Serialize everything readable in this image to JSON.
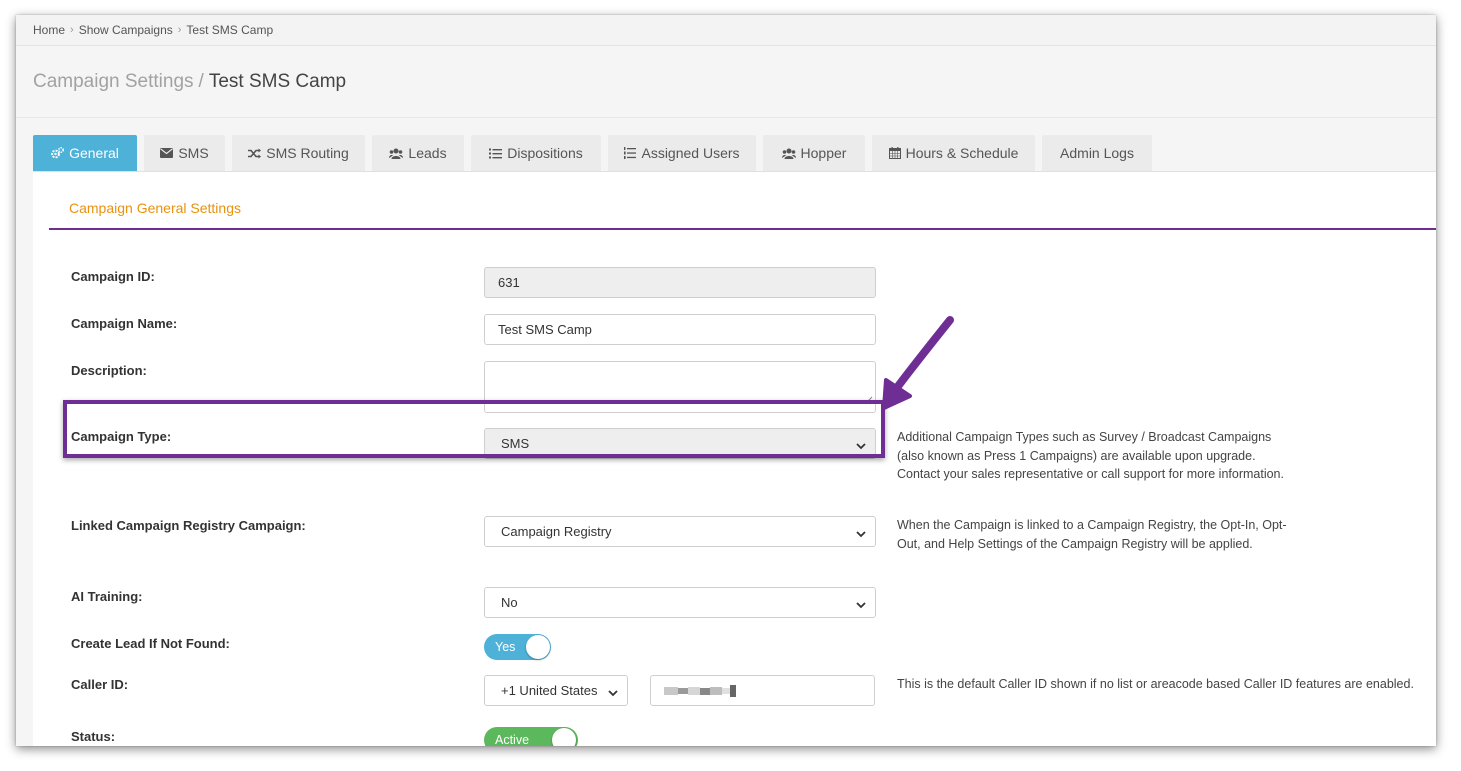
{
  "breadcrumb": {
    "items": [
      "Home",
      "Show Campaigns",
      "Test SMS Camp"
    ]
  },
  "header": {
    "section": "Campaign Settings",
    "separator": "/",
    "campaign": "Test SMS Camp"
  },
  "tabs": [
    {
      "label": "General",
      "icon": "gears-icon",
      "active": true
    },
    {
      "label": "SMS",
      "icon": "envelope-icon",
      "active": false
    },
    {
      "label": "SMS Routing",
      "icon": "shuffle-icon",
      "active": false
    },
    {
      "label": "Leads",
      "icon": "users-icon",
      "active": false
    },
    {
      "label": "Dispositions",
      "icon": "list-icon",
      "active": false
    },
    {
      "label": "Assigned Users",
      "icon": "ordered-list-icon",
      "active": false
    },
    {
      "label": "Hopper",
      "icon": "users-icon",
      "active": false
    },
    {
      "label": "Hours & Schedule",
      "icon": "calendar-icon",
      "active": false
    },
    {
      "label": "Admin Logs",
      "icon": "",
      "active": false
    }
  ],
  "section_title": "Campaign General Settings",
  "form": {
    "campaign_id": {
      "label": "Campaign ID:",
      "value": "631"
    },
    "campaign_name": {
      "label": "Campaign Name:",
      "value": "Test SMS Camp"
    },
    "description": {
      "label": "Description:",
      "value": ""
    },
    "campaign_type": {
      "label": "Campaign Type:",
      "value": "SMS",
      "help": "Additional Campaign Types such as Survey / Broadcast Campaigns (also known as Press 1 Campaigns) are available upon upgrade. Contact your sales representative or call support for more information."
    },
    "linked_registry": {
      "label": "Linked Campaign Registry Campaign:",
      "value": "Campaign Registry",
      "help": "When the Campaign is linked to a Campaign Registry, the Opt-In, Opt-Out, and Help Settings of the Campaign Registry will be applied."
    },
    "ai_training": {
      "label": "AI Training:",
      "value": "No"
    },
    "create_lead": {
      "label": "Create Lead If Not Found:",
      "value": "Yes"
    },
    "caller_id": {
      "label": "Caller ID:",
      "country": "+1 United States",
      "help": "This is the default Caller ID shown if no list or areacode based Caller ID features are enabled."
    },
    "status": {
      "label": "Status:",
      "value": "Active"
    }
  },
  "colors": {
    "active_tab": "#4db1d8",
    "section_title": "#e8920f",
    "accent_purple": "#6e2e93",
    "toggle_yes": "#4db1d8",
    "toggle_active": "#5cb85c"
  }
}
